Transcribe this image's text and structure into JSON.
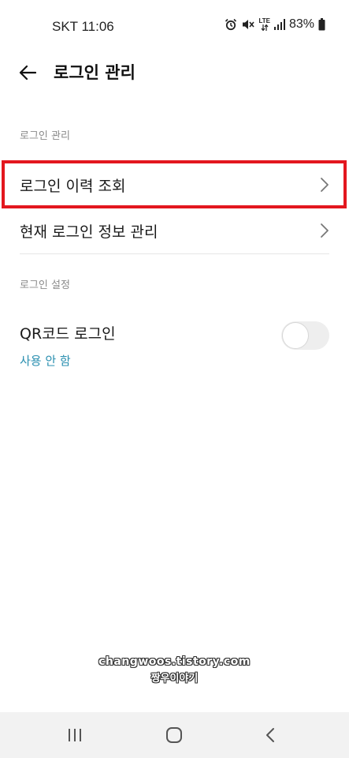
{
  "status_bar": {
    "carrier_time": "SKT 11:06",
    "network": "LTE",
    "battery": "83%"
  },
  "header": {
    "title": "로그인 관리"
  },
  "sections": [
    {
      "label": "로그인 관리",
      "items": [
        {
          "label": "로그인 이력 조회",
          "highlighted": true
        },
        {
          "label": "현재 로그인 정보 관리"
        }
      ]
    },
    {
      "label": "로그인 설정",
      "setting": {
        "title": "QR코드 로그인",
        "status": "사용 안 함",
        "enabled": false
      }
    }
  ],
  "watermark": {
    "line1": "changwoos.tistory.com",
    "line2": "짱우이야기"
  },
  "colors": {
    "accent": "#2a8fb0",
    "highlight_box": "#e3171e",
    "nav_background": "#f2f2f2"
  },
  "icons": {
    "back": "arrow-left-icon",
    "chevron": "chevron-right-icon",
    "nav_recents": "recents-icon",
    "nav_home": "home-icon",
    "nav_back": "nav-back-icon"
  }
}
